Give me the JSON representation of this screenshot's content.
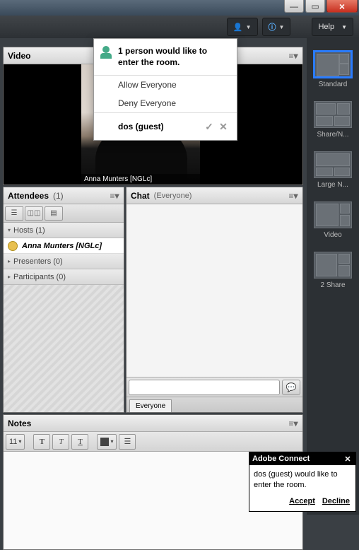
{
  "window": {
    "min": "—",
    "max": "▭",
    "close": "×"
  },
  "topbar": {
    "help": "Help"
  },
  "layouts": {
    "items": [
      {
        "label": "Standard"
      },
      {
        "label": "Share/N..."
      },
      {
        "label": "Large N..."
      },
      {
        "label": "Video"
      },
      {
        "label": "2 Share"
      }
    ]
  },
  "video": {
    "title": "Video",
    "feed_label": "Anna Munters [NGLc]"
  },
  "attendees": {
    "title": "Attendees",
    "count": "(1)",
    "sections": {
      "hosts": {
        "label": "Hosts (1)"
      },
      "presenters": {
        "label": "Presenters (0)"
      },
      "participants": {
        "label": "Participants (0)"
      }
    },
    "host_row": "Anna Munters [NGLc]"
  },
  "chat": {
    "title": "Chat",
    "scope": "(Everyone)",
    "tab": "Everyone"
  },
  "notes": {
    "title": "Notes",
    "fontsize": "11"
  },
  "knocking": {
    "text": "1 person would like to enter the room.",
    "allow": "Allow Everyone",
    "deny": "Deny Everyone",
    "guest": "dos (guest)"
  },
  "toast": {
    "title": "Adobe Connect",
    "body": "dos (guest) would like to enter the room.",
    "accept": "Accept",
    "decline": "Decline"
  }
}
